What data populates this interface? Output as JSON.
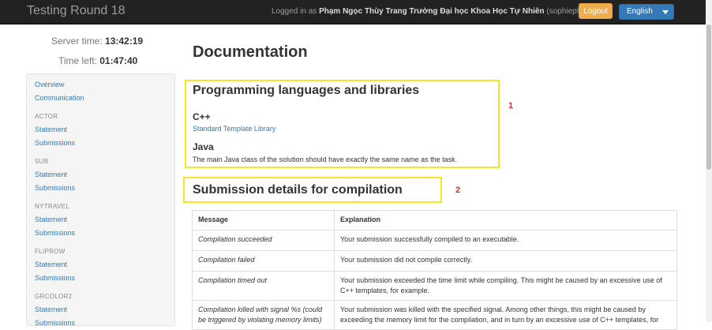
{
  "navbar": {
    "brand": "Testing Round 18",
    "logged_in_prefix": "Logged in as ",
    "user_full_name": "Phạm Ngọc Thùy Trang Trường Đại học Khoa Học Tự Nhiên",
    "username": "(sophiepham2k)",
    "logout_label": "Logout",
    "language": "English"
  },
  "timers": {
    "server_time_label": "Server time:",
    "server_time_value": "13:42:19",
    "time_left_label": "Time left:",
    "time_left_value": "01:47:40"
  },
  "sidebar": {
    "overview": "Overview",
    "communication": "Communication",
    "tasks": [
      {
        "name": "ACTOR",
        "statement": "Statement",
        "submissions": "Submissions"
      },
      {
        "name": "SUB",
        "statement": "Statement",
        "submissions": "Submissions"
      },
      {
        "name": "NYTRAVEL",
        "statement": "Statement",
        "submissions": "Submissions"
      },
      {
        "name": "FLIPROW",
        "statement": "Statement",
        "submissions": "Submissions"
      },
      {
        "name": "GRCOLOR2",
        "statement": "Statement",
        "submissions": "Submissions"
      }
    ]
  },
  "main": {
    "title": "Documentation",
    "section1": {
      "heading": "Programming languages and libraries",
      "cpp_heading": "C++",
      "cpp_link": "Standard Template Library",
      "java_heading": "Java",
      "java_text": "The main Java class of the solution should have exactly the same name as the task."
    },
    "section2": {
      "heading": "Submission details for compilation"
    },
    "annotations": {
      "one": "1",
      "two": "2"
    },
    "annotation_color": "#e52b20",
    "highlight_color": "#f7e628",
    "table": {
      "headers": [
        "Message",
        "Explanation"
      ],
      "rows": [
        {
          "message": "Compilation succeeded",
          "explanation": "Your submission successfully compiled to an executable."
        },
        {
          "message": "Compilation failed",
          "explanation": "Your submission did not compile correctly."
        },
        {
          "message": "Compilation timed out",
          "explanation": "Your submission exceeded the time limit while compiling. This might be caused by an excessive use of C++ templates, for example."
        },
        {
          "message": "Compilation killed with signal %s (could be triggered by violating memory limits)",
          "explanation": "Your submission was killed with the specified signal. Among other things, this might be caused by exceeding the memory limit for the compilation, and in turn by an excessive use of C++ templates, for"
        }
      ]
    }
  }
}
